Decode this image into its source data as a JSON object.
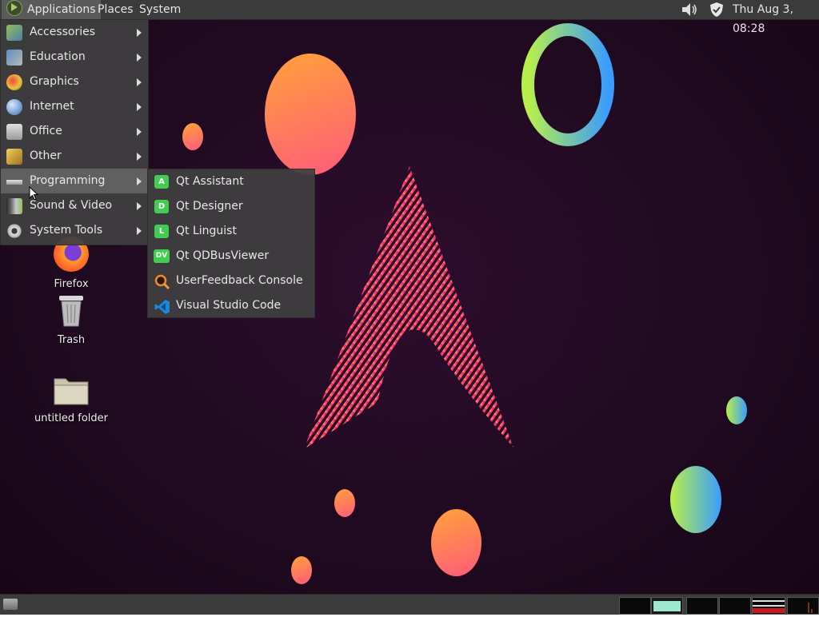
{
  "top_panel": {
    "menus": [
      "Applications",
      "Places",
      "System"
    ],
    "clock": "Thu Aug  3, 08:28",
    "icons": [
      "volume-icon",
      "shield-icon"
    ]
  },
  "app_menu": {
    "items": [
      {
        "label": "Accessories",
        "icon": "accessories-icon"
      },
      {
        "label": "Education",
        "icon": "education-icon"
      },
      {
        "label": "Graphics",
        "icon": "graphics-icon"
      },
      {
        "label": "Internet",
        "icon": "internet-icon"
      },
      {
        "label": "Office",
        "icon": "office-icon"
      },
      {
        "label": "Other",
        "icon": "other-icon"
      },
      {
        "label": "Programming",
        "icon": "programming-icon"
      },
      {
        "label": "Sound & Video",
        "icon": "sound-video-icon"
      },
      {
        "label": "System Tools",
        "icon": "system-tools-icon"
      }
    ],
    "active": "Programming"
  },
  "programming_submenu": {
    "items": [
      {
        "label": "Qt Assistant",
        "badge": "A"
      },
      {
        "label": "Qt Designer",
        "badge": "D"
      },
      {
        "label": "Qt Linguist",
        "badge": "L"
      },
      {
        "label": "Qt QDBusViewer",
        "badge": "DV"
      },
      {
        "label": "UserFeedback Console",
        "icon": "magnifier-icon"
      },
      {
        "label": "Visual Studio Code",
        "icon": "vscode-icon"
      }
    ]
  },
  "desktop_icons": [
    {
      "label": "Firefox",
      "icon": "firefox-icon"
    },
    {
      "label": "Trash",
      "icon": "trash-icon"
    },
    {
      "label": "untitled folder",
      "icon": "folder-icon"
    }
  ],
  "colors": {
    "panel": "#3b3b3b",
    "menu_bg": "#404040",
    "highlight": "#606060",
    "qt_green": "#41cd52"
  }
}
